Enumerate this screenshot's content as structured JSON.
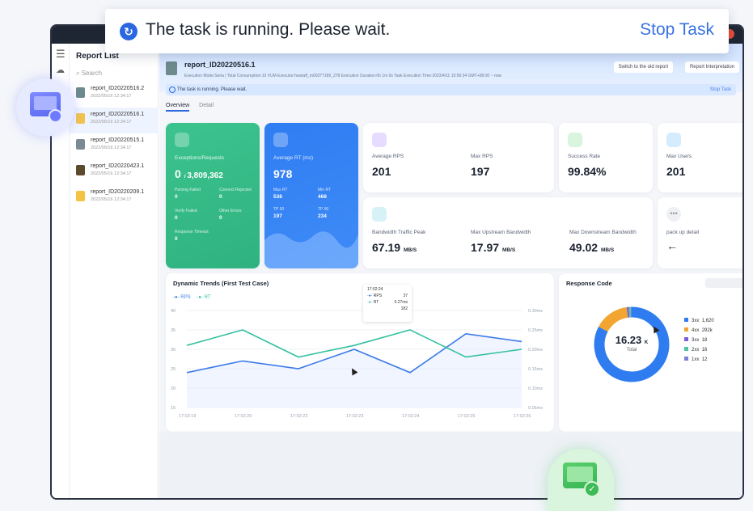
{
  "toast": {
    "message": "The task is running. Please wait.",
    "stop_label": "Stop Task",
    "icon": "refresh-icon"
  },
  "report_list": {
    "title": "Report List",
    "search_placeholder": "Search",
    "items": [
      {
        "name": "report_ID20220516.2",
        "date": "2022/05/16 12:34:17",
        "color": "#6d8a8d"
      },
      {
        "name": "report_ID20220516.1",
        "date": "2022/05/16 12:34:17",
        "color": "#f2c34b"
      },
      {
        "name": "report_ID20220515.1",
        "date": "2022/05/16 12:34:17",
        "color": "#7c8b93"
      },
      {
        "name": "report_ID20220423.1",
        "date": "2022/05/16 12:34:17",
        "color": "#5b4a2c"
      },
      {
        "name": "report_ID20220209.1",
        "date": "2022/05/16 12:34:17",
        "color": "#f4c343"
      }
    ]
  },
  "report": {
    "name": "report_ID20220516.1",
    "meta": "Execution Mode:Seria  |  Total Consumption:10 VUM   Executor:hwstaff_m00377189_278   Execution Duration:0h 1m 0s   Task Execution Time:2023/4/11 15:56:34 GMT+08:00 ~ now",
    "old_report_label": "Switch to the old report",
    "interpretation_label": "Report Interpretation",
    "banner": "The task is running. Please wait.",
    "banner_stop": "Stop Task",
    "tabs": [
      "Overview",
      "Detail"
    ]
  },
  "exceptions_card": {
    "label": "Exceptions/Requests",
    "value": "0",
    "total": "3,809,362",
    "parsing_failed_label": "Parsing Failed",
    "parsing_failed": "0",
    "connect_rejected_label": "Connect Rejected",
    "connect_rejected": "0",
    "verify_failed_label": "Verify Failed",
    "verify_failed": "0",
    "other_errors_label": "Other Errors",
    "other_errors": "0",
    "timeout_label": "Response Timeout",
    "timeout": "0"
  },
  "rt_card": {
    "label": "Average RT (ms)",
    "value": "978",
    "max_rt_label": "Max RT",
    "max_rt": "538",
    "min_rt_label": "Min RT",
    "min_rt": "468",
    "tp50_label": "TP 50",
    "tp50": "197",
    "tp90_label": "TP 90",
    "tp90": "234"
  },
  "metrics": {
    "avg_rps_label": "Average RPS",
    "avg_rps": "201",
    "max_rps_label": "Max RPS",
    "max_rps": "197",
    "success_label": "Success Rate",
    "success": "99.84%",
    "max_users_label": "Max Users",
    "max_users": "201",
    "traffic_label": "Bandwidth Traffic Peak",
    "traffic": "67.19",
    "traffic_unit": "MB/S",
    "up_label": "Max Upstream Bandwidth",
    "up": "17.97",
    "up_unit": "MB/S",
    "down_label": "Max Downstream Bandwidth",
    "down": "49.02",
    "down_unit": "MB/S",
    "pack_label": "pack up detail",
    "more_icon": "ellipsis-icon"
  },
  "trend": {
    "title": "Dynamic Trends (First Test Case)",
    "legend_rps": "RPS",
    "legend_rt": "RT",
    "tooltip_time": "17:02:24",
    "tooltip_rps_label": "RPS",
    "tooltip_rps": "37",
    "tooltip_rt_label": "RT",
    "tooltip_rt": "0.27ms",
    "tooltip_extra": "182"
  },
  "response": {
    "title": "Response Code",
    "total": "16.23",
    "total_unit": "K",
    "total_label": "Total"
  },
  "chart_data": [
    {
      "type": "line",
      "x": [
        "17:02:19",
        "17:02:20",
        "17:02:22",
        "17:02:23",
        "17:02:24",
        "17:02:25",
        "17:02:26"
      ],
      "series": [
        {
          "name": "RPS",
          "color": "#3b7be8",
          "values": [
            24,
            27,
            25,
            30,
            24,
            34,
            32
          ]
        },
        {
          "name": "RT",
          "color": "#34c1a0",
          "values": [
            31,
            35,
            28,
            31,
            35,
            28,
            30
          ]
        }
      ],
      "y_left_ticks": [
        "40",
        "35",
        "30",
        "25",
        "20",
        "15"
      ],
      "y_right_ticks": [
        "0.30ms",
        "0.25ms",
        "0.20ms",
        "0.15ms",
        "0.10ms",
        "0.05ms"
      ],
      "ylim": [
        15,
        40
      ]
    },
    {
      "type": "pie",
      "categories": [
        "3xx",
        "4xx",
        "3xx",
        "2xx",
        "1xx"
      ],
      "display_values": [
        "1,620",
        "292k",
        "18",
        "16",
        "12"
      ],
      "values": [
        1620,
        292,
        18,
        16,
        12
      ],
      "colors": [
        "#2f7cf0",
        "#f2a531",
        "#7c5ce0",
        "#48c7a7",
        "#7b7fd6"
      ]
    }
  ]
}
